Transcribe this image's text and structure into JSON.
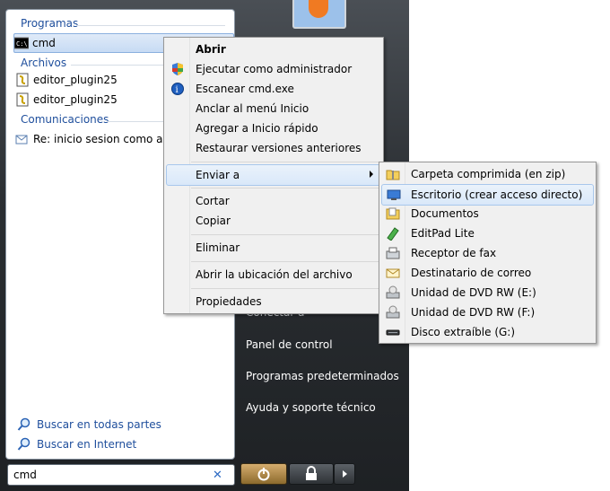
{
  "left_pane": {
    "groups": [
      {
        "title": "Programas",
        "items": [
          "cmd"
        ]
      },
      {
        "title": "Archivos",
        "items": [
          "editor_plugin25",
          "editor_plugin25"
        ]
      },
      {
        "title": "Comunicaciones",
        "items": [
          "Re: inicio sesion como adm"
        ]
      }
    ],
    "search_links": [
      "Buscar en todas partes",
      "Buscar en Internet"
    ],
    "search_value": "cmd"
  },
  "right_pane": {
    "partial_item": "Conectar a",
    "items": [
      "Panel de control",
      "Programas predeterminados",
      "Ayuda y soporte técnico"
    ]
  },
  "context_menu": {
    "items": [
      {
        "label": "Abrir",
        "bold": true
      },
      {
        "label": "Ejecutar como administrador",
        "icon": "shield-icon"
      },
      {
        "label": "Escanear cmd.exe",
        "icon": "antivirus-icon"
      },
      {
        "label": "Anclar al menú Inicio"
      },
      {
        "label": "Agregar a Inicio rápido"
      },
      {
        "label": "Restaurar versiones anteriores"
      },
      {
        "label": "Enviar a"
      },
      {
        "label": "Cortar"
      },
      {
        "label": "Copiar"
      },
      {
        "label": "Eliminar"
      },
      {
        "label": "Abrir la ubicación del archivo"
      },
      {
        "label": "Propiedades"
      }
    ]
  },
  "sendto_menu": {
    "items": [
      {
        "label": "Carpeta comprimida (en zip)",
        "icon": "zip-folder-icon"
      },
      {
        "label": "Escritorio (crear acceso directo)",
        "icon": "desktop-icon"
      },
      {
        "label": "Documentos",
        "icon": "documents-folder-icon"
      },
      {
        "label": "EditPad Lite",
        "icon": "editpad-icon"
      },
      {
        "label": "Receptor de fax",
        "icon": "fax-icon"
      },
      {
        "label": "Destinatario de correo",
        "icon": "mail-icon"
      },
      {
        "label": "Unidad de DVD RW (E:)",
        "icon": "dvd-drive-icon"
      },
      {
        "label": "Unidad de DVD RW (F:)",
        "icon": "dvd-drive-icon"
      },
      {
        "label": "Disco extraíble (G:)",
        "icon": "removable-disk-icon"
      }
    ]
  },
  "colors": {
    "group_title": "#1e4e9c",
    "menu_bg": "#f0f0f0",
    "highlight_border": "#a8c7ec"
  }
}
